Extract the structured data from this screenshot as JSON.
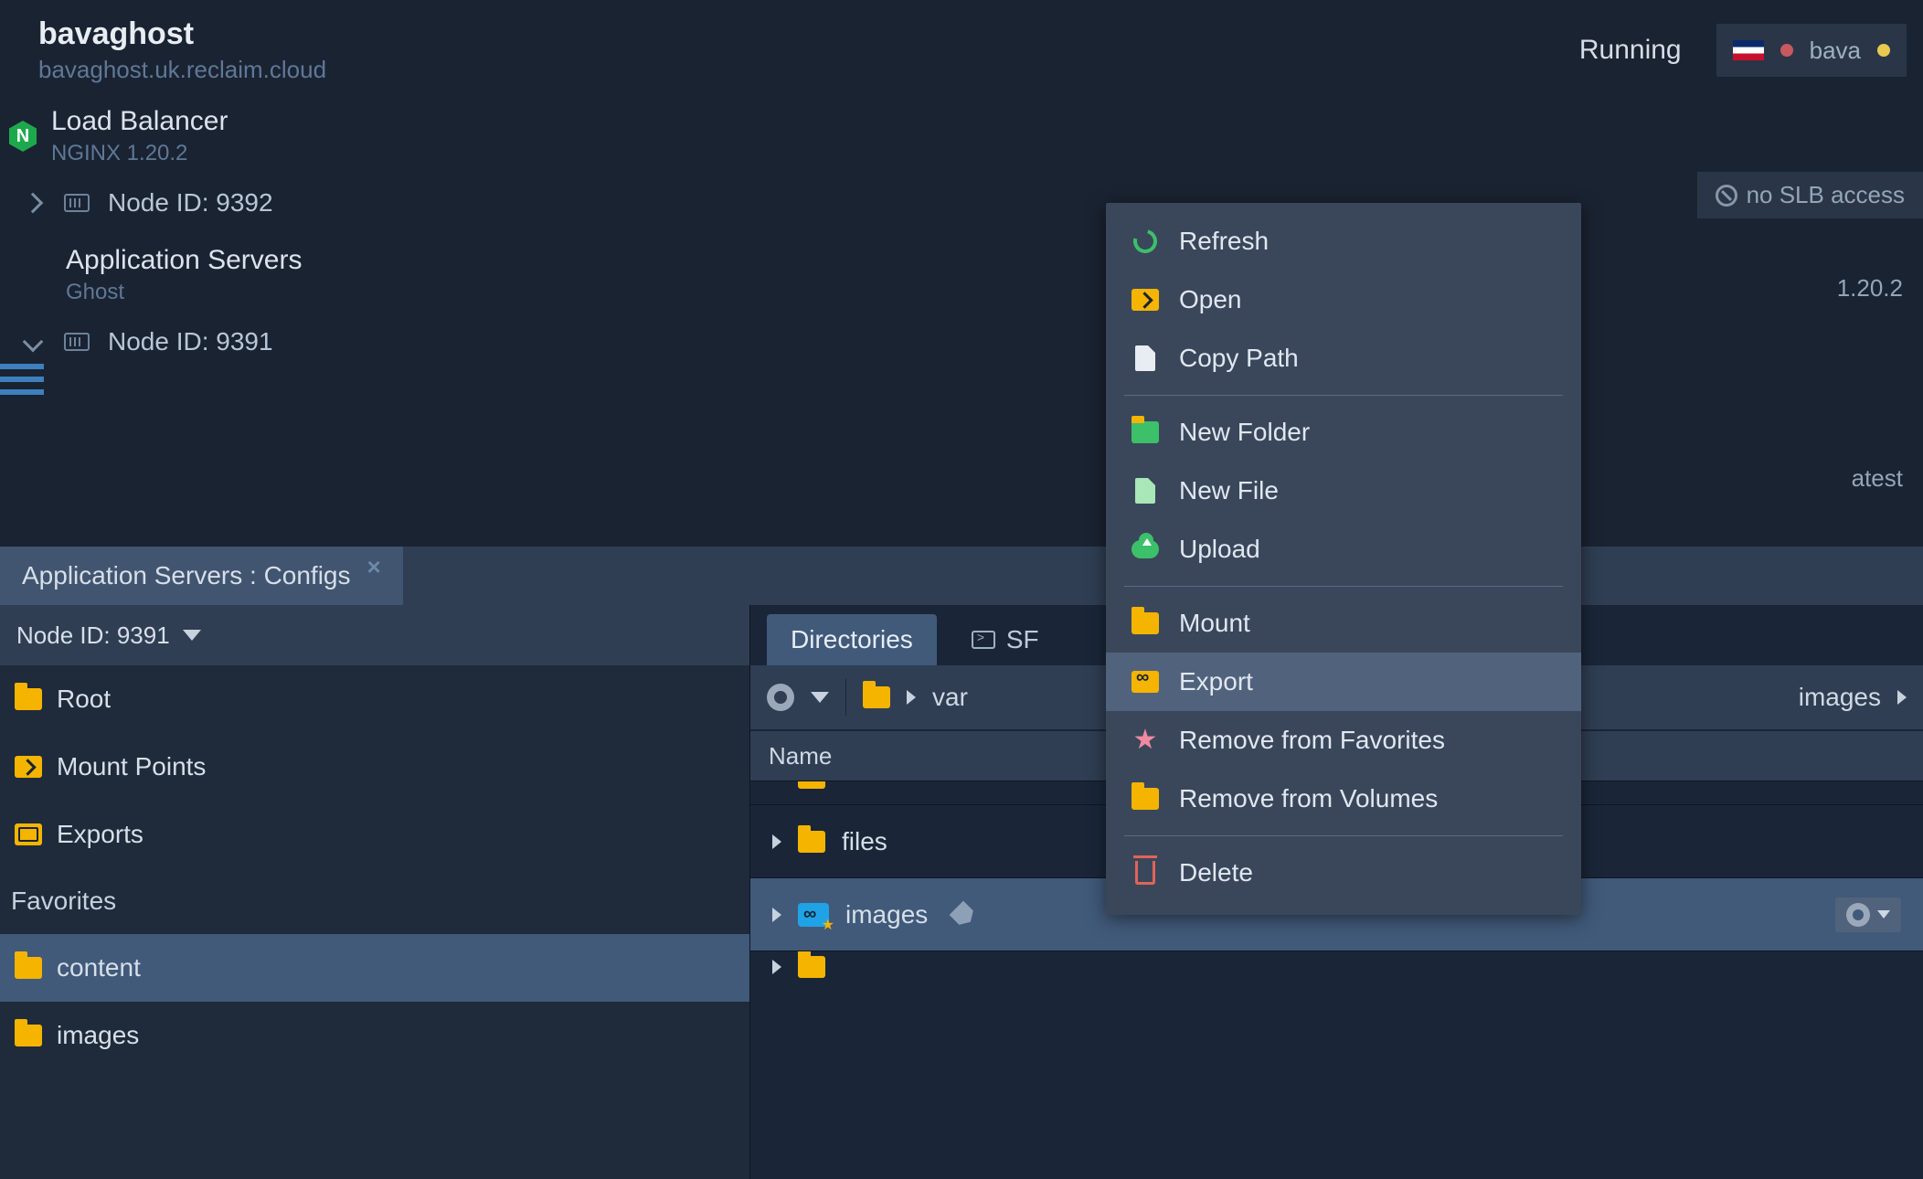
{
  "env": {
    "name": "bavaghost",
    "domain": "bavaghost.uk.reclaim.cloud",
    "status": "Running",
    "owner_chip": "bava"
  },
  "slb_text": "no SLB access",
  "right_text_1": "1.20.2",
  "right_text_2": "atest",
  "nodes": {
    "load_balancer": {
      "title": "Load Balancer",
      "subtitle": "NGINX 1.20.2",
      "node_label": "Node ID: 9392"
    },
    "app_servers": {
      "title": "Application Servers",
      "subtitle": "Ghost",
      "node_label": "Node ID: 9391"
    }
  },
  "tab": {
    "label": "Application Servers : Configs"
  },
  "side": {
    "selector": "Node ID: 9391",
    "items": {
      "root": "Root",
      "mounts": "Mount Points",
      "exports": "Exports"
    },
    "fav_header": "Favorites",
    "fav": {
      "content": "content",
      "images": "images"
    }
  },
  "main": {
    "tab_directories": "Directories",
    "tab_sf_partial": "SF",
    "breadcrumb": {
      "var": "var",
      "images": "images"
    },
    "col_name": "Name",
    "rows": {
      "files": "files",
      "images": "images"
    }
  },
  "ctx": {
    "refresh": "Refresh",
    "open": "Open",
    "copy_path": "Copy Path",
    "new_folder": "New Folder",
    "new_file": "New File",
    "upload": "Upload",
    "mount": "Mount",
    "export": "Export",
    "remove_fav": "Remove from Favorites",
    "remove_vol": "Remove from Volumes",
    "delete": "Delete"
  }
}
